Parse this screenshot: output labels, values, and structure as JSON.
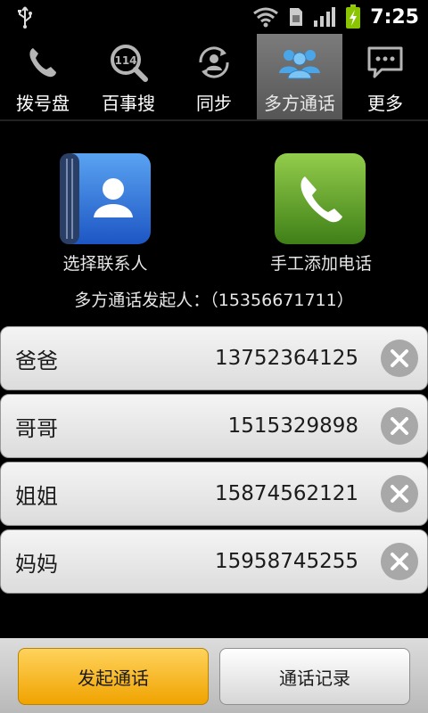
{
  "status_bar": {
    "time": "7:25",
    "icons": [
      "usb-icon",
      "wifi-icon",
      "sim-icon",
      "signal-icon",
      "battery-charging-icon"
    ]
  },
  "tabs": [
    {
      "label": "拨号盘",
      "icon": "phone-handset-icon",
      "active": false
    },
    {
      "label": "百事搜",
      "icon": "search-114-icon",
      "active": false
    },
    {
      "label": "同步",
      "icon": "sync-contact-icon",
      "active": false
    },
    {
      "label": "多方通话",
      "icon": "group-call-icon",
      "active": true
    },
    {
      "label": "更多",
      "icon": "more-chat-icon",
      "active": false
    }
  ],
  "actions": {
    "select_contact": "选择联系人",
    "manual_add": "手工添加电话"
  },
  "initiator_text": "多方通话发起人：（15356671711）",
  "participants": [
    {
      "name": "爸爸",
      "number": "13752364125"
    },
    {
      "name": "哥哥",
      "number": "1515329898"
    },
    {
      "name": "姐姐",
      "number": "15874562121"
    },
    {
      "name": "妈妈",
      "number": "15958745255"
    }
  ],
  "bottom": {
    "start_call": "发起通话",
    "call_log": "通话记录"
  },
  "colors": {
    "accent_active_tab": "#6b6b6b",
    "start_button": "#f5b31e",
    "contacts_tile": "#2f6fd9",
    "manual_tile": "#5b9e2b"
  }
}
